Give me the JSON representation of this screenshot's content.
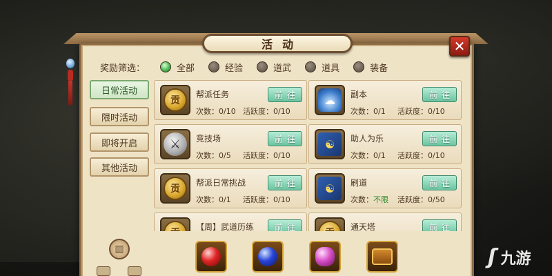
{
  "window": {
    "title": "活动",
    "close_glyph": "✕"
  },
  "filter": {
    "label": "奖励筛选：",
    "options": [
      {
        "label": "全部",
        "selected": true
      },
      {
        "label": "经验",
        "selected": false
      },
      {
        "label": "道武",
        "selected": false
      },
      {
        "label": "道具",
        "selected": false
      },
      {
        "label": "装备",
        "selected": false
      }
    ]
  },
  "tabs": [
    {
      "label": "日常活动",
      "active": true
    },
    {
      "label": "限时活动",
      "active": false
    },
    {
      "label": "即将开启",
      "active": false
    },
    {
      "label": "其他活动",
      "active": false
    }
  ],
  "activities": [
    {
      "name": "帮派任务",
      "icon": "gong-coin-icon",
      "icon_glyph": "贡",
      "count_label": "次数：",
      "count": "0/10",
      "active_label": "活跃度：",
      "active": "0/10",
      "button": "前往"
    },
    {
      "name": "副本",
      "icon": "dungeon-cloud-icon",
      "icon_glyph": "☁",
      "count_label": "次数：",
      "count": "0/1",
      "active_label": "活跃度：",
      "active": "0/10",
      "button": "前往"
    },
    {
      "name": "竞技场",
      "icon": "crossed-swords-icon",
      "icon_glyph": "⚔",
      "count_label": "次数：",
      "count": "0/5",
      "active_label": "活跃度：",
      "active": "0/10",
      "button": "前往"
    },
    {
      "name": "助人为乐",
      "icon": "helping-book-icon",
      "icon_glyph": "☯",
      "count_label": "次数：",
      "count": "0/1",
      "active_label": "活跃度：",
      "active": "0/10",
      "button": "前往"
    },
    {
      "name": "帮派日常挑战",
      "icon": "gong-coin-icon",
      "icon_glyph": "贡",
      "count_label": "次数：",
      "count": "0/1",
      "active_label": "活跃度：",
      "active": "0/10",
      "button": "前往"
    },
    {
      "name": "刷道",
      "icon": "taiji-book-icon",
      "icon_glyph": "☯",
      "count_label": "次数：",
      "count": "不限",
      "active_label": "活跃度：",
      "active": "0/50",
      "button": "前往"
    },
    {
      "name": "【周】武道历练",
      "icon": "gong-coin-icon",
      "icon_glyph": "贡",
      "button": "前往"
    },
    {
      "name": "通天塔",
      "icon": "gong-coin-icon",
      "icon_glyph": "贡",
      "button": "前往"
    }
  ],
  "rewards": [
    {
      "icon": "red-gem-icon"
    },
    {
      "icon": "blue-gem-icon"
    },
    {
      "icon": "pink-gem-icon"
    },
    {
      "icon": "treasure-chest-icon"
    }
  ],
  "watermark": {
    "text": "九游"
  },
  "colors": {
    "accent_green": "#6cc4a0",
    "close_red": "#d33a2c",
    "panel_bg": "#efe3c6",
    "brown_text": "#4b3520"
  }
}
